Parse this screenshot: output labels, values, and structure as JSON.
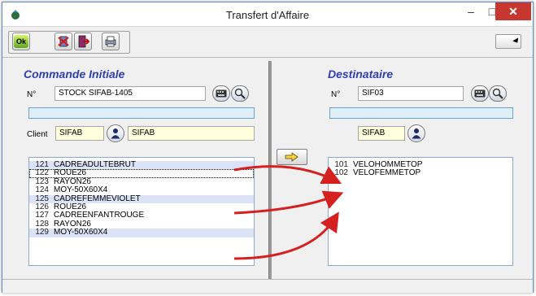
{
  "window": {
    "title": "Transfert d'Affaire",
    "minimize_glyph": "–",
    "maximize_glyph": "□",
    "close_glyph": "✕"
  },
  "toolbar": {
    "ok_label": "Ok"
  },
  "left": {
    "title": "Commande Initiale",
    "number_label": "N°",
    "number_value": "STOCK SIFAB-1405",
    "client_label": "Client",
    "client_code": "SIFAB",
    "client_name": "SIFAB",
    "items": [
      {
        "num": "121",
        "name": "CADREADULTEBRUT"
      },
      {
        "num": "122",
        "name": "ROUE26"
      },
      {
        "num": "123",
        "name": "RAYON26"
      },
      {
        "num": "124",
        "name": "MOY-50X60X4"
      },
      {
        "num": "125",
        "name": "CADREFEMMEVIOLET"
      },
      {
        "num": "126",
        "name": "ROUE26"
      },
      {
        "num": "127",
        "name": "CADREENFANTROUGE"
      },
      {
        "num": "128",
        "name": "RAYON26"
      },
      {
        "num": "129",
        "name": "MOY-50X60X4"
      }
    ]
  },
  "right": {
    "title": "Destinataire",
    "number_label": "N°",
    "number_value": "SIF03",
    "client_code": "SIFAB",
    "items": [
      {
        "num": "101",
        "name": "VELOHOMMETOP"
      },
      {
        "num": "102",
        "name": "VELOFEMMETOP"
      }
    ]
  },
  "colors": {
    "section_title": "#2f3fb0",
    "close_button": "#c7372f",
    "alt_row": "#dde3f6",
    "yellow_field": "#ffffdd",
    "arrow": "#d62020"
  },
  "icons": [
    "app-icon",
    "ok-icon",
    "delete-icon",
    "exit-icon",
    "print-icon",
    "keyboard-icon",
    "magnifier-icon",
    "user-icon",
    "arrow-right-icon",
    "dropdown-icon"
  ]
}
